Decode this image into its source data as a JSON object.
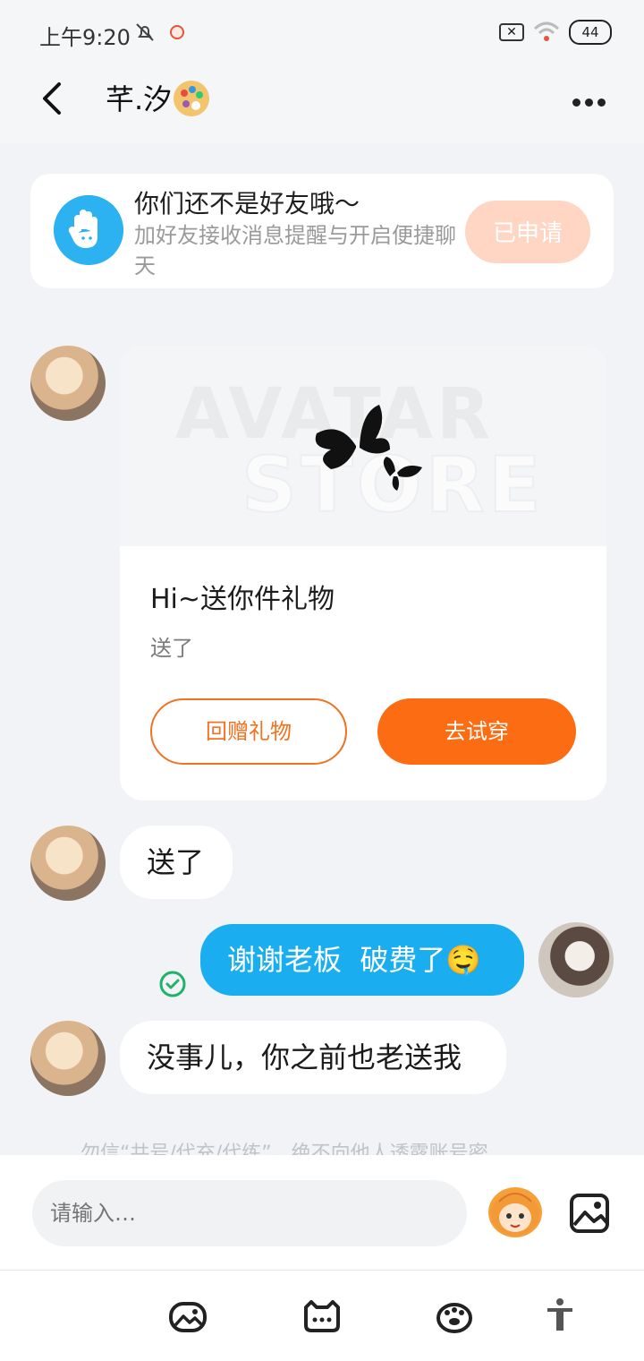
{
  "status_bar": {
    "time": "上午9:20",
    "battery": "44"
  },
  "header": {
    "title": "芊.汐"
  },
  "friend_banner": {
    "title": "你们还不是好友哦～",
    "subtitle": "加好友接收消息提醒与开启便捷聊天",
    "button": "已申请"
  },
  "gift_card": {
    "watermark_top": "AVATAR",
    "watermark_bottom": "STORE",
    "title": "Hi~送你件礼物",
    "subtitle": "送了",
    "return_button": "回赠礼物",
    "try_button": "去试穿"
  },
  "messages": [
    {
      "side": "left",
      "text": "送了"
    },
    {
      "side": "right",
      "text": "谢谢老板  破费了🤤"
    },
    {
      "side": "left",
      "text": "没事儿，你之前也老送我"
    }
  ],
  "hint": "勿信“共号/代充/代练”，绝不向他人透露账号密",
  "input": {
    "placeholder": "请输入…"
  },
  "colors": {
    "accent_orange": "#fc6c12",
    "bubble_blue": "#1aaef0",
    "banner_button": "#ffd6c4"
  }
}
